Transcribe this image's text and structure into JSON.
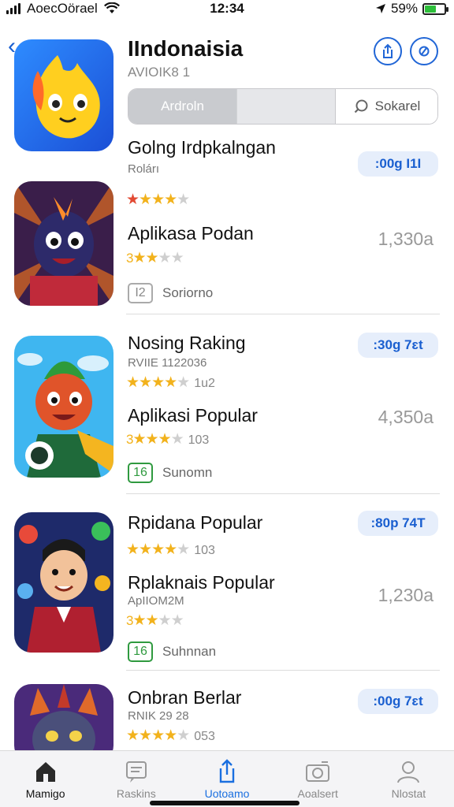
{
  "status_bar": {
    "carrier": "AoecOörael",
    "time": "12:34",
    "battery": "59%",
    "battery_level": 0.59
  },
  "header": {
    "title": "IIndonaisia",
    "subtitle": "AVIOIK8 1",
    "segment_active": "Ardroln",
    "search_label": "Sokarel"
  },
  "items": [
    {
      "title": "Golng Irdpkalngan",
      "meta": "Rolárı",
      "button": ":00g I1I"
    },
    {
      "title": "Aplikasa Podan",
      "rating": "3",
      "count": "1,330a",
      "age": "I2",
      "age_label": "Soriorno"
    },
    {
      "title": "Nosing Raking",
      "meta": "RVIIE 1122036",
      "rating_count": "1u2",
      "button": ":30g 7ɛt"
    },
    {
      "title": "Aplikasi Popular",
      "rating": "3",
      "rating_count": "103",
      "count": "4,350a",
      "age": "16",
      "age_label": "Sunomn"
    },
    {
      "title": "Rpidana Popular",
      "rating_count": "103",
      "button": ":80p 74T"
    },
    {
      "title": "Rplaknais Popular",
      "meta": "ApIIOM2M",
      "rating": "3",
      "count": "1,230a",
      "age": "16",
      "age_label": "Suhnnan"
    },
    {
      "title": "Onbran Berlar",
      "meta": "RNIK 29 28",
      "rating_count": "053",
      "button": ":00g 7ɛt"
    }
  ],
  "tabs": [
    {
      "label": "Mamigo",
      "icon": "home-icon"
    },
    {
      "label": "Raskins",
      "icon": "ranking-icon"
    },
    {
      "label": "Uotoamo",
      "icon": "share-icon"
    },
    {
      "label": "Aoalsert",
      "icon": "camera-icon"
    },
    {
      "label": "Nlostat",
      "icon": "profile-icon"
    }
  ],
  "colors": {
    "accent": "#1a5fd0",
    "star": "#f2b21c",
    "age_green": "#2f9a3f"
  }
}
